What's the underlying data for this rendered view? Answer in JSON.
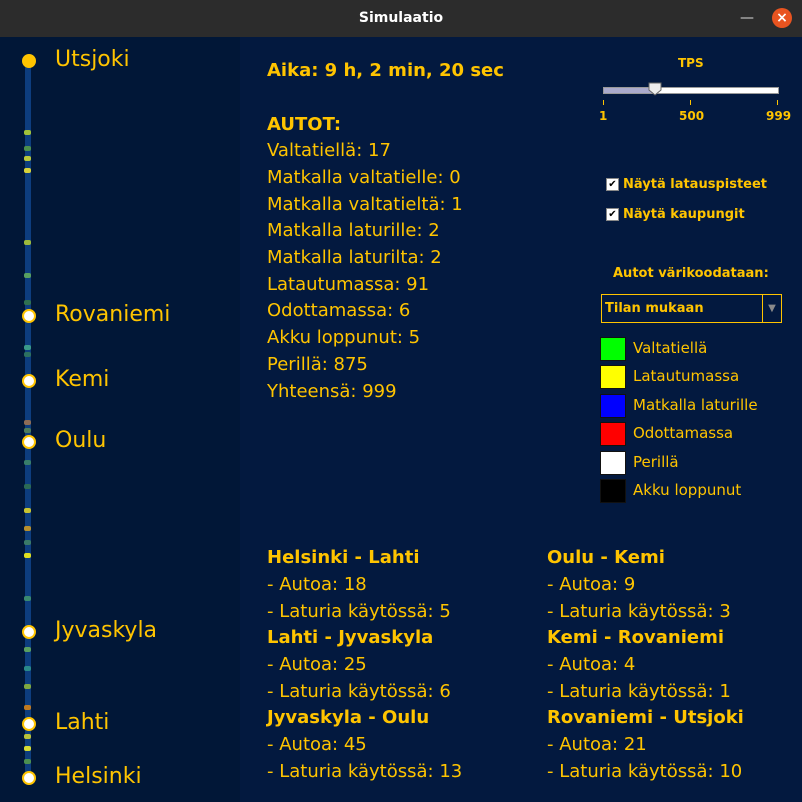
{
  "window": {
    "title": "Simulaatio"
  },
  "cities": [
    {
      "name": "Utsjoki"
    },
    {
      "name": "Rovaniemi"
    },
    {
      "name": "Kemi"
    },
    {
      "name": "Oulu"
    },
    {
      "name": "Jyvaskyla"
    },
    {
      "name": "Lahti"
    },
    {
      "name": "Helsinki"
    }
  ],
  "stats": {
    "time": "Aika: 9 h, 2 min, 20 sec",
    "heading": "AUTOT:",
    "lines": [
      "Valtatiellä: 17",
      "Matkalla valtatielle: 0",
      "Matkalla valtatieltä: 1",
      "Matkalla laturille: 2",
      "Matkalla laturilta: 2",
      "Latautumassa: 91",
      "Odottamassa: 6",
      "Akku loppunut: 5",
      "Perillä: 875",
      "Yhteensä: 999"
    ]
  },
  "tps": {
    "label": "TPS",
    "min_label": "1",
    "mid_label": "500",
    "max_label": "999",
    "value": 300,
    "min": 1,
    "max": 999
  },
  "checkboxes": [
    {
      "label": "Näytä latauspisteet",
      "checked": true
    },
    {
      "label": "Näytä kaupungit",
      "checked": true
    }
  ],
  "color_select": {
    "label": "Autot värikoodataan:",
    "value": "Tilan mukaan"
  },
  "legend": [
    {
      "label": "Valtatiellä",
      "color": "#00ff00"
    },
    {
      "label": "Latautumassa",
      "color": "#ffff00"
    },
    {
      "label": "Matkalla laturille",
      "color": "#0000ff"
    },
    {
      "label": "Odottamassa",
      "color": "#ff0000"
    },
    {
      "label": "Perillä",
      "color": "#ffffff"
    },
    {
      "label": "Akku loppunut",
      "color": "#000000"
    }
  ],
  "segments": [
    {
      "title": "Helsinki - Lahti",
      "cars": " - Autoa: 18",
      "chargers": " - Laturia käytössä: 5"
    },
    {
      "title": "Lahti - Jyvaskyla",
      "cars": " - Autoa: 25",
      "chargers": " - Laturia käytössä: 6"
    },
    {
      "title": "Jyvaskyla - Oulu",
      "cars": " - Autoa: 45",
      "chargers": " - Laturia käytössä: 13"
    },
    {
      "title": "Oulu - Kemi",
      "cars": " - Autoa: 9",
      "chargers": " - Laturia käytössä: 3"
    },
    {
      "title": "Kemi - Rovaniemi",
      "cars": " - Autoa: 4",
      "chargers": " - Laturia käytössä: 1"
    },
    {
      "title": "Rovaniemi - Utsjoki",
      "cars": " - Autoa: 21",
      "chargers": " - Laturia käytössä: 10"
    }
  ],
  "colors": {
    "accent": "#ffc400",
    "background": "#03193f",
    "road": "#0d3d7e"
  }
}
